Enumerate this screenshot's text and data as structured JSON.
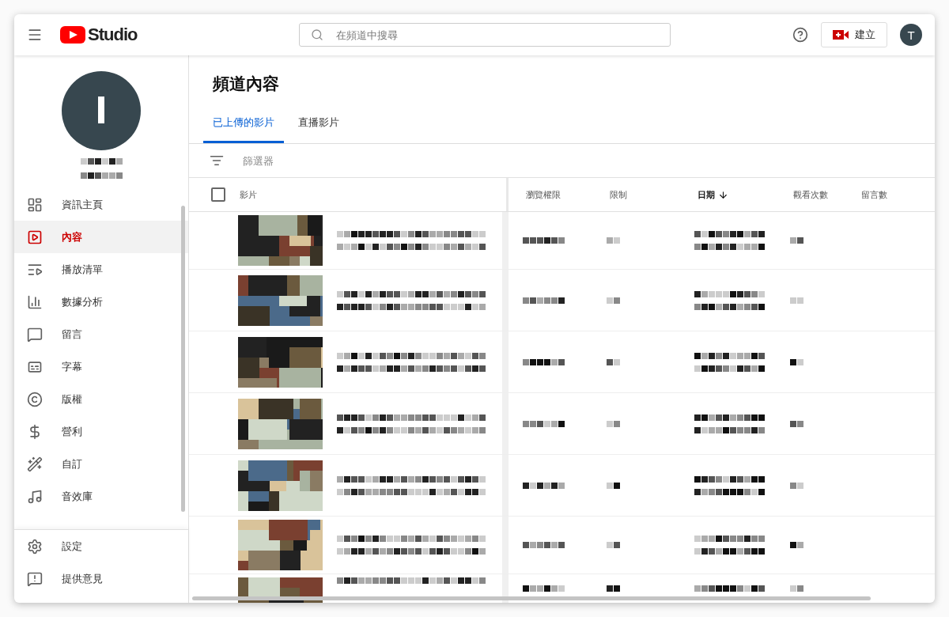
{
  "header": {
    "logo_text": "Studio",
    "search": {
      "placeholder": "在頻道中搜尋"
    },
    "create_button": "建立",
    "avatar": "T"
  },
  "sidebar": {
    "items": [
      {
        "label": "資訊主頁",
        "selected": false
      },
      {
        "label": "內容",
        "selected": true
      },
      {
        "label": "播放清單",
        "selected": false
      },
      {
        "label": "數據分析",
        "selected": false
      },
      {
        "label": "留言",
        "selected": false
      },
      {
        "label": "字幕",
        "selected": false
      },
      {
        "label": "版權",
        "selected": false
      },
      {
        "label": "營利",
        "selected": false
      },
      {
        "label": "自訂",
        "selected": false
      },
      {
        "label": "音效庫",
        "selected": false
      }
    ],
    "footer": [
      {
        "label": "設定"
      },
      {
        "label": "提供意見"
      }
    ]
  },
  "page": {
    "title": "頻道內容",
    "tabs": [
      {
        "label": "已上傳的影片",
        "selected": true
      },
      {
        "label": "直播影片",
        "selected": false
      }
    ],
    "filter": {
      "placeholder": "篩選器"
    },
    "table": {
      "select_all": {
        "checked": false
      },
      "columns": [
        {
          "label": "影片",
          "sorted": false
        },
        {
          "label": "瀏覽權限",
          "sorted": false
        },
        {
          "label": "限制",
          "sorted": false
        },
        {
          "label": "日期",
          "sorted": true
        },
        {
          "label": "觀看次數",
          "sorted": false
        },
        {
          "label": "留言數",
          "sorted": false
        }
      ]
    }
  }
}
